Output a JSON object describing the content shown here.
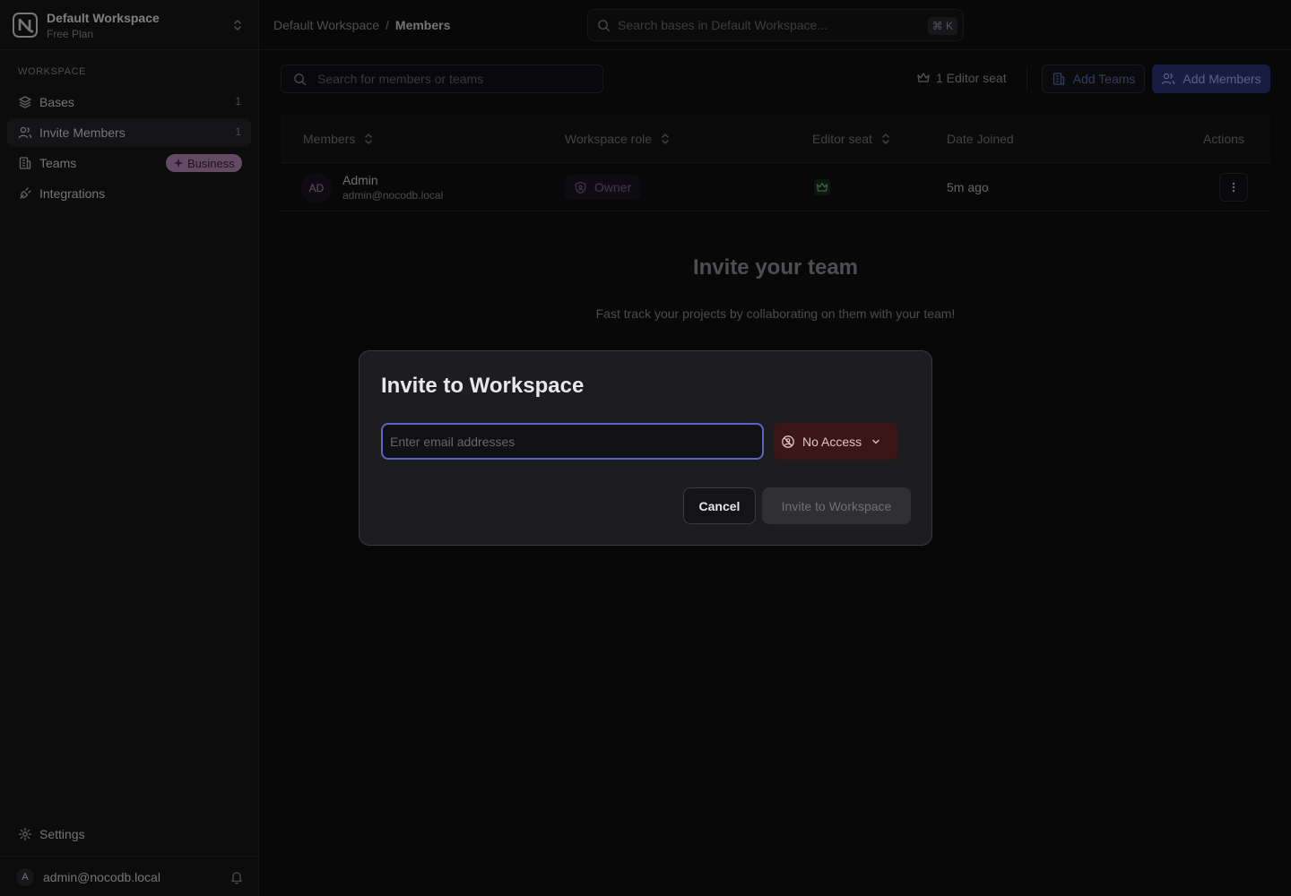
{
  "workspace": {
    "name": "Default Workspace",
    "plan": "Free Plan"
  },
  "sidebar": {
    "section_label": "WORKSPACE",
    "items": [
      {
        "label": "Bases",
        "count": "1",
        "icon": "database-icon"
      },
      {
        "label": "Invite Members",
        "count": "1",
        "icon": "users-icon",
        "active": true
      },
      {
        "label": "Teams",
        "badge": "Business",
        "icon": "building-icon"
      },
      {
        "label": "Integrations",
        "icon": "plug-icon"
      }
    ],
    "settings_label": "Settings",
    "user": {
      "initial": "A",
      "email": "admin@nocodb.local"
    }
  },
  "topbar": {
    "breadcrumb": [
      "Default Workspace",
      "Members"
    ],
    "breadcrumb_sep": "/",
    "search_placeholder": "Search bases in Default Workspace...",
    "shortcut": "⌘ K"
  },
  "members": {
    "search_placeholder": "Search for members or teams",
    "editor_seats": "1 Editor seat",
    "add_teams_label": "Add Teams",
    "add_members_label": "Add Members",
    "columns": [
      "Members",
      "Workspace role",
      "Editor seat",
      "Date Joined",
      "Actions"
    ],
    "rows": [
      {
        "initials": "AD",
        "name": "Admin",
        "email": "admin@nocodb.local",
        "role": "Owner",
        "date_joined": "5m ago"
      }
    ]
  },
  "empty_state": {
    "title": "Invite your team",
    "subtitle": "Fast track your projects by collaborating on them with your team!"
  },
  "modal": {
    "title": "Invite to Workspace",
    "email_placeholder": "Enter email addresses",
    "email_value": "",
    "access_label": "No Access",
    "cancel_label": "Cancel",
    "submit_label": "Invite to Workspace"
  },
  "colors": {
    "accent": "#2c3278",
    "input_focus": "#5a63c7",
    "no_access_bg": "#3a1616",
    "business_badge": "#b58bb4"
  }
}
